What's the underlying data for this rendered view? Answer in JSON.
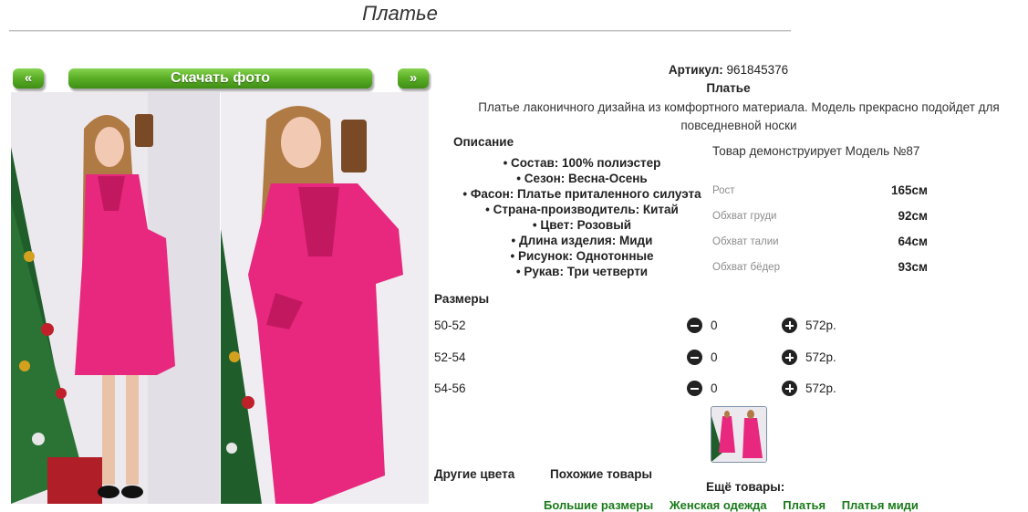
{
  "page": {
    "title": "Платье"
  },
  "gallery": {
    "prev_label": "«",
    "download_label": "Скачать фото",
    "next_label": "»"
  },
  "product": {
    "article_label": "Артикул:",
    "article_value": "961845376",
    "name": "Платье",
    "description": "Платье лаконичного дизайна из комфортного материала. Модель прекрасно подойдет для повседневной носки"
  },
  "specs": {
    "heading": "Описание",
    "items": [
      "• Состав: 100% полиэстер",
      "• Сезон: Весна-Осень",
      "• Фасон: Платье приталенного силуэта",
      "• Страна-производитель: Китай",
      "• Цвет: Розовый",
      "• Длина изделия: Миди",
      "• Рисунок: Однотонные",
      "• Рукав: Три четверти"
    ]
  },
  "model": {
    "text": "Товар демонструирует Модель №87",
    "measurements": [
      {
        "label": "Рост",
        "value": "165см"
      },
      {
        "label": "Обхват груди",
        "value": "92см"
      },
      {
        "label": "Обхват талии",
        "value": "64см"
      },
      {
        "label": "Обхват бёдер",
        "value": "93см"
      }
    ]
  },
  "sizes": {
    "heading": "Размеры",
    "rows": [
      {
        "size": "50-52",
        "qty": "0",
        "price": "572р."
      },
      {
        "size": "52-54",
        "qty": "0",
        "price": "572р."
      },
      {
        "size": "54-56",
        "qty": "0",
        "price": "572р."
      }
    ]
  },
  "footer": {
    "other_colors": "Другие цвета",
    "similar": "Похожие товары",
    "more_label": "Ещё товары:",
    "links": [
      "Большие размеры",
      "Женская одежда",
      "Платья",
      "Платья миди"
    ]
  },
  "colors": {
    "dress": "#e8287e",
    "button_green": "#59ad25",
    "link_green": "#1a7a1a"
  }
}
